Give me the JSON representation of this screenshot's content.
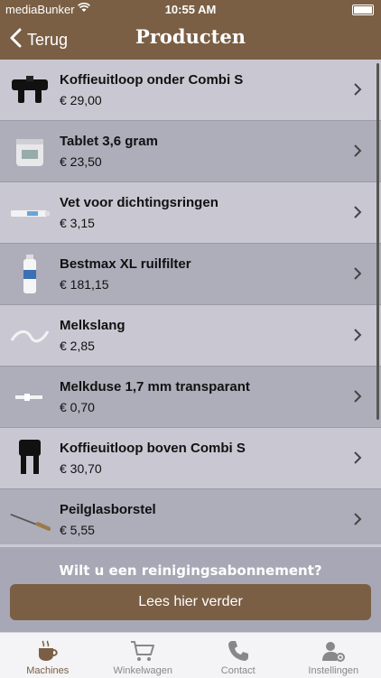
{
  "status": {
    "carrier": "mediaBunker",
    "time": "10:55 AM"
  },
  "nav": {
    "back_label": "Terug",
    "title": "Producten"
  },
  "products": [
    {
      "name": "Koffieuitloop onder Combi S",
      "price": "€ 29,00"
    },
    {
      "name": "Tablet 3,6 gram",
      "price": "€ 23,50"
    },
    {
      "name": "Vet voor dichtingsringen",
      "price": "€ 3,15"
    },
    {
      "name": "Bestmax XL ruilfilter",
      "price": "€ 181,15"
    },
    {
      "name": "Melkslang",
      "price": "€ 2,85"
    },
    {
      "name": "Melkduse 1,7 mm transparant",
      "price": "€ 0,70"
    },
    {
      "name": "Koffieuitloop boven Combi S",
      "price": "€ 30,70"
    },
    {
      "name": "Peilglasborstel",
      "price": "€ 5,55"
    }
  ],
  "promo": {
    "question": "Wilt u een reinigingsabonnement?",
    "button": "Lees hier verder"
  },
  "tabs": [
    {
      "label": "Machines",
      "icon": "coffee-cup-icon",
      "active": true
    },
    {
      "label": "Winkelwagen",
      "icon": "cart-icon",
      "active": false
    },
    {
      "label": "Contact",
      "icon": "phone-icon",
      "active": false
    },
    {
      "label": "Instellingen",
      "icon": "user-settings-icon",
      "active": false
    }
  ],
  "colors": {
    "brand": "#7a5f45",
    "row_light": "#c9c8d2",
    "row_dark": "#aeadba"
  }
}
